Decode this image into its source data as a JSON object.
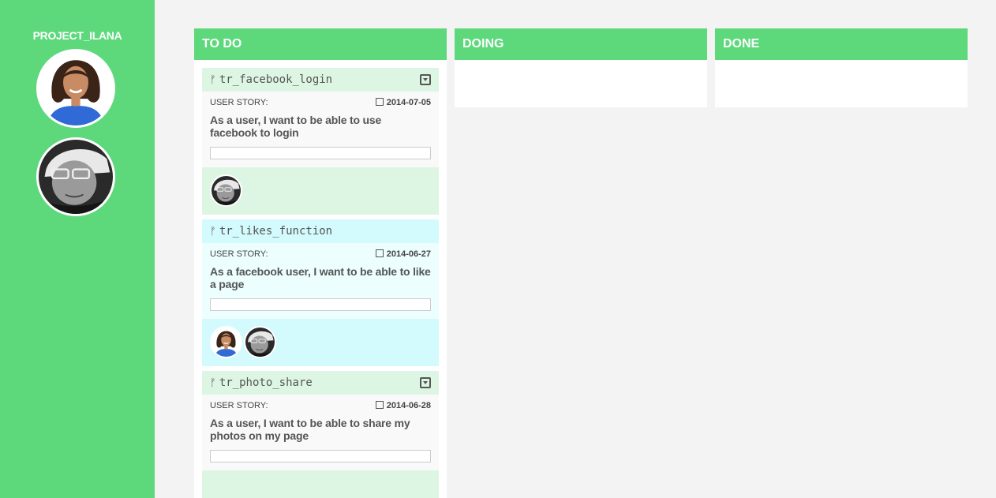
{
  "sidebar": {
    "project_name": "PROJECT_ILANA",
    "members": [
      {
        "name": "woman-avatar"
      },
      {
        "name": "man-avatar"
      }
    ]
  },
  "board": {
    "columns": [
      {
        "title": "TO DO"
      },
      {
        "title": "DOING"
      },
      {
        "title": "DONE"
      }
    ],
    "cards": [
      {
        "title": "tr_facebook_login",
        "label": "USER STORY:",
        "date": "2014-07-05",
        "story": "As a user, I want to be able to use facebook to login",
        "color": "#ddf6e3"
      },
      {
        "title": "tr_likes_function",
        "label": "USER STORY:",
        "date": "2014-06-27",
        "story": "As a facebook user, I want to be able to like a page",
        "color": "#d3fafd"
      },
      {
        "title": "tr_photo_share",
        "label": "USER STORY:",
        "date": "2014-06-28",
        "story": "As a user, I want to be able to share my photos on my page",
        "color": "#ddf6e3"
      }
    ]
  },
  "colors": {
    "accent": "#5dd97c",
    "background": "#f3f3f3",
    "card_green": "#ddf6e3",
    "card_cyan": "#d3fafd"
  }
}
